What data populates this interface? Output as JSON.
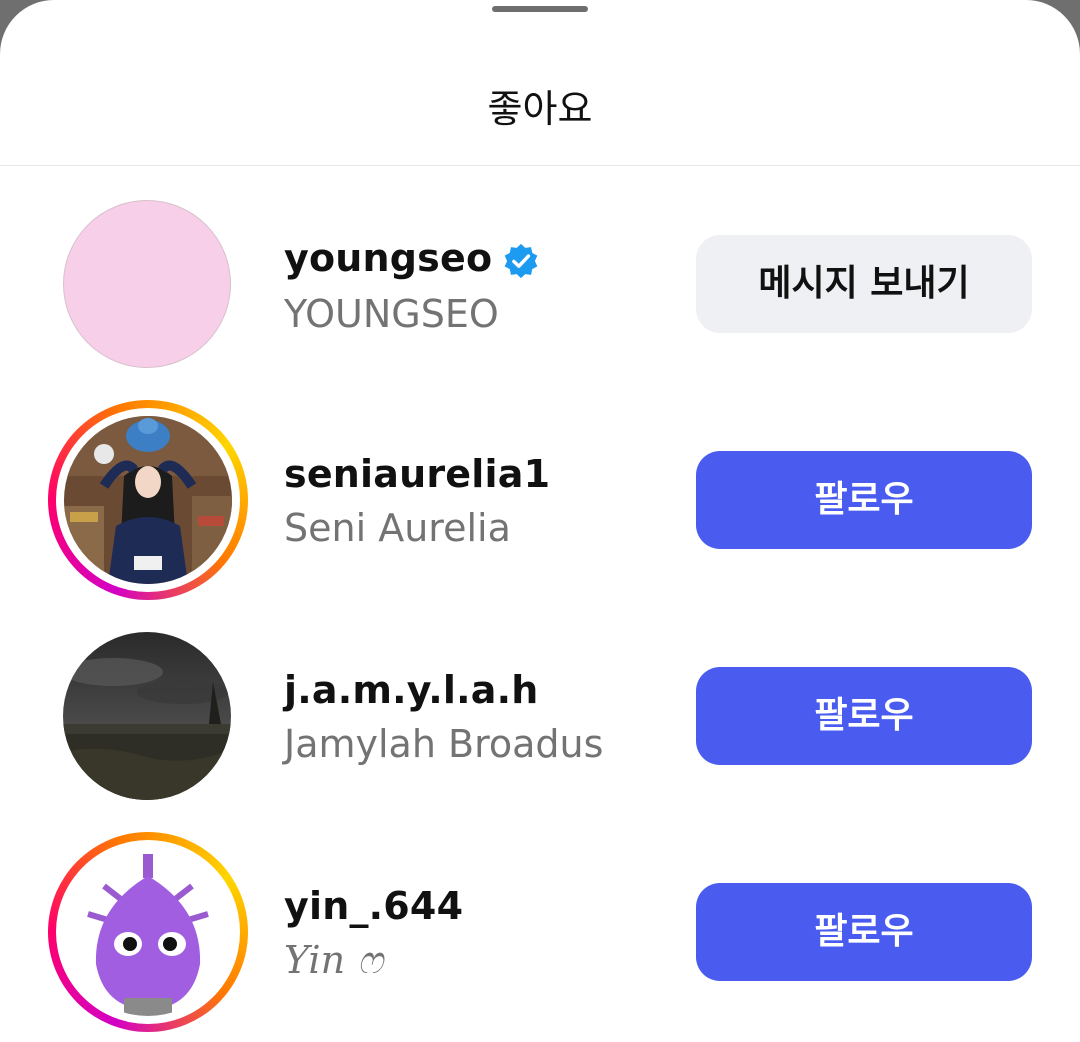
{
  "sheet": {
    "title": "좋아요"
  },
  "likes": [
    {
      "username": "youngseo",
      "full_name": "YOUNGSEO",
      "verified": true,
      "has_story": false,
      "button_label": "메시지 보내기",
      "button_style": "secondary"
    },
    {
      "username": "seniaurelia1",
      "full_name": "Seni Aurelia",
      "verified": false,
      "has_story": true,
      "button_label": "팔로우",
      "button_style": "primary"
    },
    {
      "username": "j.a.m.y.l.a.h",
      "full_name": "Jamylah Broadus",
      "verified": false,
      "has_story": false,
      "button_label": "팔로우",
      "button_style": "primary"
    },
    {
      "username": "yin_.644",
      "full_name": "Yin ෆ",
      "verified": false,
      "has_story": true,
      "button_label": "팔로우",
      "button_style": "primary"
    }
  ],
  "colors": {
    "follow_button": "#4a5cf0",
    "message_button": "#eff0f4",
    "verified_badge": "#1d9bf0",
    "secondary_text": "#737373"
  },
  "icons": {
    "verified": "verified-badge-icon"
  }
}
